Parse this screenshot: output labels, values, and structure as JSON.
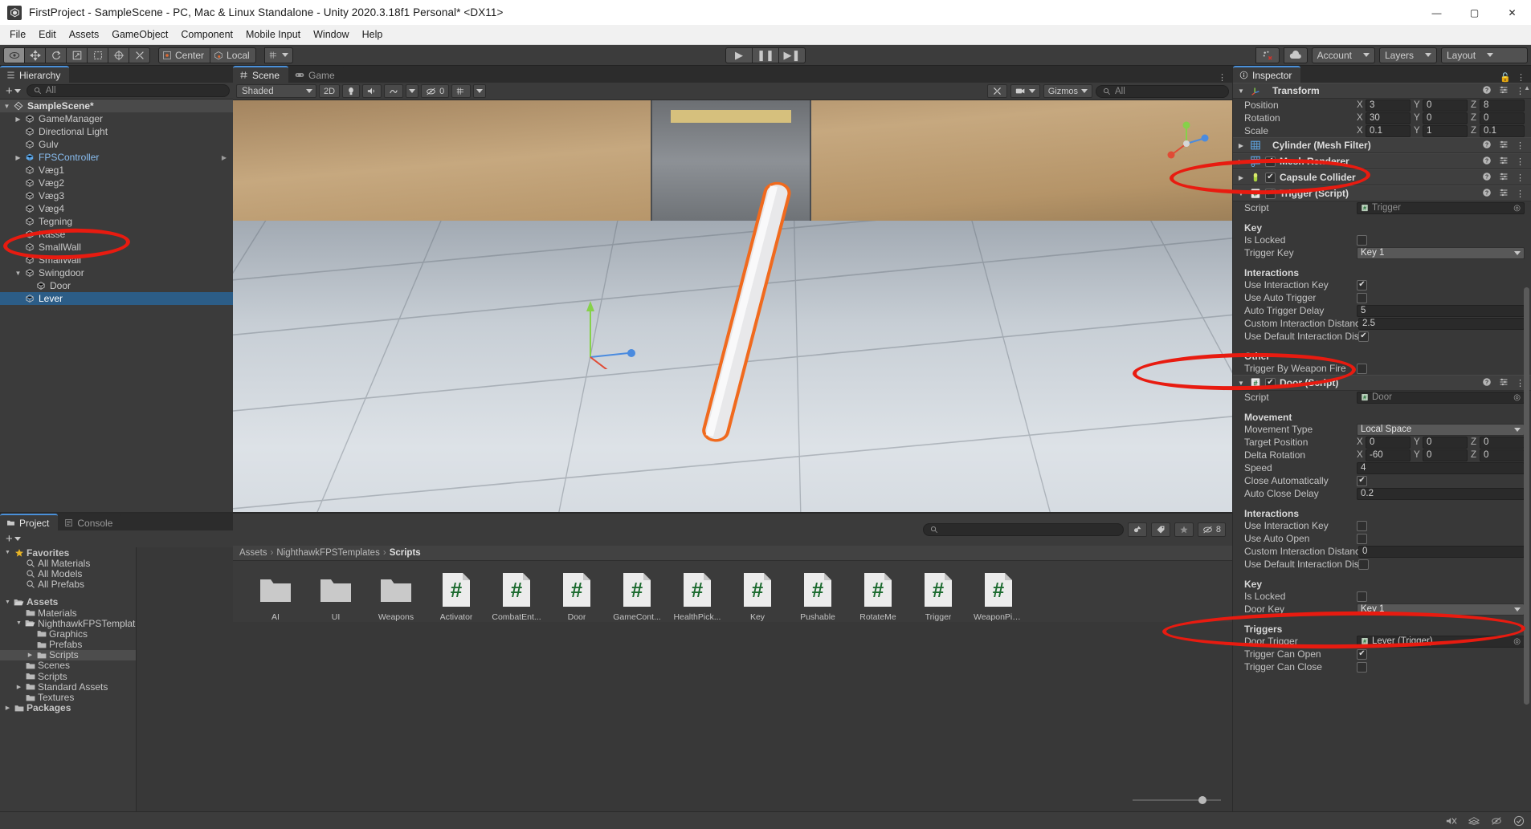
{
  "window": {
    "title": "FirstProject - SampleScene - PC, Mac & Linux Standalone - Unity 2020.3.18f1 Personal* <DX11>",
    "minimize": "—",
    "maximize": "▢",
    "close": "✕"
  },
  "menubar": {
    "items": [
      "File",
      "Edit",
      "Assets",
      "GameObject",
      "Component",
      "Mobile Input",
      "Window",
      "Help"
    ]
  },
  "toolbar": {
    "tools": [
      "hand-tool",
      "move-tool",
      "rotate-tool",
      "scale-tool",
      "rect-tool",
      "transform-tool",
      "custom-tool"
    ],
    "pivot_mode": "Center",
    "pivot_space": "Local",
    "play": "▶",
    "pause": "❚❚",
    "step": "▶❚",
    "collab_label": "",
    "cloud_label": "",
    "account": "Account",
    "layers": "Layers",
    "layout": "Layout"
  },
  "hierarchy": {
    "tab": "Hierarchy",
    "search_placeholder": "All",
    "create_label": "+",
    "items": [
      {
        "label": "SampleScene*",
        "depth": 0,
        "arrow": "▼",
        "type": "scene",
        "selected": false
      },
      {
        "label": "GameManager",
        "depth": 1,
        "arrow": "▶",
        "type": "go",
        "selected": false
      },
      {
        "label": "Directional Light",
        "depth": 1,
        "arrow": "",
        "type": "go",
        "selected": false
      },
      {
        "label": "Gulv",
        "depth": 1,
        "arrow": "",
        "type": "go",
        "selected": false
      },
      {
        "label": "FPSController",
        "depth": 1,
        "arrow": "▶",
        "type": "prefab",
        "selected": false
      },
      {
        "label": "Væg1",
        "depth": 1,
        "arrow": "",
        "type": "go",
        "selected": false
      },
      {
        "label": "Væg2",
        "depth": 1,
        "arrow": "",
        "type": "go",
        "selected": false
      },
      {
        "label": "Væg3",
        "depth": 1,
        "arrow": "",
        "type": "go",
        "selected": false
      },
      {
        "label": "Væg4",
        "depth": 1,
        "arrow": "",
        "type": "go",
        "selected": false
      },
      {
        "label": "Tegning",
        "depth": 1,
        "arrow": "",
        "type": "go",
        "selected": false
      },
      {
        "label": "Kasse",
        "depth": 1,
        "arrow": "",
        "type": "go",
        "selected": false
      },
      {
        "label": "SmallWall",
        "depth": 1,
        "arrow": "",
        "type": "go",
        "selected": false
      },
      {
        "label": "SmallWall",
        "depth": 1,
        "arrow": "",
        "type": "go",
        "selected": false
      },
      {
        "label": "Swingdoor",
        "depth": 1,
        "arrow": "▼",
        "type": "go",
        "selected": false
      },
      {
        "label": "Door",
        "depth": 2,
        "arrow": "",
        "type": "go",
        "selected": false
      },
      {
        "label": "Lever",
        "depth": 1,
        "arrow": "",
        "type": "go",
        "selected": true
      }
    ]
  },
  "scene_view": {
    "tabs": [
      {
        "label": "Scene",
        "active": true
      },
      {
        "label": "Game",
        "active": false
      }
    ],
    "shading_mode": "Shaded",
    "two_d": "2D",
    "audio": "",
    "effects_count": "0",
    "gizmos": "Gizmos",
    "search_placeholder": "All"
  },
  "project": {
    "tabs": [
      {
        "label": "Project",
        "active": true
      },
      {
        "label": "Console",
        "active": false
      }
    ],
    "search_placeholder": "",
    "hidden_count": "8",
    "breadcrumb": [
      "Assets",
      "NighthawkFPSTemplates",
      "Scripts"
    ],
    "tree": [
      {
        "label": "Favorites",
        "depth": 0,
        "arrow": "▼",
        "icon": "star",
        "bold": true,
        "sel": false
      },
      {
        "label": "All Materials",
        "depth": 1,
        "arrow": "",
        "icon": "search",
        "bold": false,
        "sel": false
      },
      {
        "label": "All Models",
        "depth": 1,
        "arrow": "",
        "icon": "search",
        "bold": false,
        "sel": false
      },
      {
        "label": "All Prefabs",
        "depth": 1,
        "arrow": "",
        "icon": "search",
        "bold": false,
        "sel": false
      },
      {
        "label": "",
        "depth": 0,
        "arrow": "",
        "icon": "none",
        "bold": false,
        "sel": false
      },
      {
        "label": "Assets",
        "depth": 0,
        "arrow": "▼",
        "icon": "folder-open",
        "bold": true,
        "sel": false
      },
      {
        "label": "Materials",
        "depth": 1,
        "arrow": "",
        "icon": "folder",
        "bold": false,
        "sel": false
      },
      {
        "label": "NighthawkFPSTemplates",
        "depth": 1,
        "arrow": "▼",
        "icon": "folder-open",
        "bold": false,
        "sel": false
      },
      {
        "label": "Graphics",
        "depth": 2,
        "arrow": "",
        "icon": "folder",
        "bold": false,
        "sel": false
      },
      {
        "label": "Prefabs",
        "depth": 2,
        "arrow": "",
        "icon": "folder",
        "bold": false,
        "sel": false
      },
      {
        "label": "Scripts",
        "depth": 2,
        "arrow": "▶",
        "icon": "folder",
        "bold": false,
        "sel": true
      },
      {
        "label": "Scenes",
        "depth": 1,
        "arrow": "",
        "icon": "folder",
        "bold": false,
        "sel": false
      },
      {
        "label": "Scripts",
        "depth": 1,
        "arrow": "",
        "icon": "folder",
        "bold": false,
        "sel": false
      },
      {
        "label": "Standard Assets",
        "depth": 1,
        "arrow": "▶",
        "icon": "folder",
        "bold": false,
        "sel": false
      },
      {
        "label": "Textures",
        "depth": 1,
        "arrow": "",
        "icon": "folder",
        "bold": false,
        "sel": false
      },
      {
        "label": "Packages",
        "depth": 0,
        "arrow": "▶",
        "icon": "folder",
        "bold": true,
        "sel": false
      }
    ],
    "assets": [
      {
        "name": "AI",
        "type": "folder"
      },
      {
        "name": "UI",
        "type": "folder"
      },
      {
        "name": "Weapons",
        "type": "folder"
      },
      {
        "name": "Activator",
        "type": "script"
      },
      {
        "name": "CombatEnt...",
        "type": "script"
      },
      {
        "name": "Door",
        "type": "script"
      },
      {
        "name": "GameCont...",
        "type": "script"
      },
      {
        "name": "HealthPick...",
        "type": "script"
      },
      {
        "name": "Key",
        "type": "script"
      },
      {
        "name": "Pushable",
        "type": "script"
      },
      {
        "name": "RotateMe",
        "type": "script"
      },
      {
        "name": "Trigger",
        "type": "script"
      },
      {
        "name": "WeaponPic...",
        "type": "script"
      }
    ]
  },
  "inspector": {
    "tab": "Inspector",
    "components": [
      {
        "name": "Transform",
        "icon": "transform-icon",
        "foldout": "▼",
        "has_checkbox": false,
        "rows": [
          {
            "kind": "vec3",
            "label": "Position",
            "x": "3",
            "y": "0",
            "z": "8"
          },
          {
            "kind": "vec3",
            "label": "Rotation",
            "x": "30",
            "y": "0",
            "z": "0"
          },
          {
            "kind": "vec3",
            "label": "Scale",
            "x": "0.1",
            "y": "1",
            "z": "0.1"
          }
        ]
      },
      {
        "name": "Cylinder (Mesh Filter)",
        "icon": "mesh-filter-icon",
        "foldout": "▶",
        "has_checkbox": false,
        "rows": []
      },
      {
        "name": "Mesh Renderer",
        "icon": "mesh-renderer-icon",
        "foldout": "▶",
        "has_checkbox": true,
        "checked": true,
        "rows": []
      },
      {
        "name": "Capsule Collider",
        "icon": "capsule-collider-icon",
        "foldout": "▶",
        "has_checkbox": true,
        "checked": true,
        "rows": []
      },
      {
        "name": "Trigger (Script)",
        "icon": "script-icon",
        "foldout": "▼",
        "has_checkbox": true,
        "checked": true,
        "rows": [
          {
            "kind": "obj",
            "label": "Script",
            "value": "Trigger",
            "disabled": true
          },
          {
            "kind": "spacer"
          },
          {
            "kind": "head",
            "label": "Key"
          },
          {
            "kind": "check",
            "label": "Is Locked",
            "checked": false
          },
          {
            "kind": "drop",
            "label": "Trigger Key",
            "value": "Key 1"
          },
          {
            "kind": "spacer"
          },
          {
            "kind": "head",
            "label": "Interactions"
          },
          {
            "kind": "check",
            "label": "Use Interaction Key",
            "checked": true
          },
          {
            "kind": "check",
            "label": "Use Auto Trigger",
            "checked": false
          },
          {
            "kind": "text",
            "label": "Auto Trigger Delay",
            "value": "5"
          },
          {
            "kind": "text",
            "label": "Custom Interaction Distance",
            "value": "2.5"
          },
          {
            "kind": "check",
            "label": "Use Default Interaction Dista",
            "checked": true
          },
          {
            "kind": "spacer"
          },
          {
            "kind": "head",
            "label": "Other"
          },
          {
            "kind": "check",
            "label": "Trigger By Weapon Fire",
            "checked": false
          }
        ]
      },
      {
        "name": "Door (Script)",
        "icon": "script-icon",
        "foldout": "▼",
        "has_checkbox": true,
        "checked": true,
        "rows": [
          {
            "kind": "obj",
            "label": "Script",
            "value": "Door",
            "disabled": true
          },
          {
            "kind": "spacer"
          },
          {
            "kind": "head",
            "label": "Movement"
          },
          {
            "kind": "drop",
            "label": "Movement Type",
            "value": "Local Space"
          },
          {
            "kind": "vec3",
            "label": "Target Position",
            "x": "0",
            "y": "0",
            "z": "0"
          },
          {
            "kind": "vec3",
            "label": "Delta Rotation",
            "x": "-60",
            "y": "0",
            "z": "0"
          },
          {
            "kind": "text",
            "label": "Speed",
            "value": "4"
          },
          {
            "kind": "check",
            "label": "Close Automatically",
            "checked": true
          },
          {
            "kind": "text",
            "label": "Auto Close Delay",
            "value": "0.2"
          },
          {
            "kind": "spacer"
          },
          {
            "kind": "head",
            "label": "Interactions"
          },
          {
            "kind": "check",
            "label": "Use Interaction Key",
            "checked": false
          },
          {
            "kind": "check",
            "label": "Use Auto Open",
            "checked": false
          },
          {
            "kind": "text",
            "label": "Custom Interaction Distance",
            "value": "0"
          },
          {
            "kind": "check",
            "label": "Use Default Interaction Dista",
            "checked": false
          },
          {
            "kind": "spacer"
          },
          {
            "kind": "head",
            "label": "Key"
          },
          {
            "kind": "check",
            "label": "Is Locked",
            "checked": false
          },
          {
            "kind": "drop",
            "label": "Door Key",
            "value": "Key 1"
          },
          {
            "kind": "spacer"
          },
          {
            "kind": "head",
            "label": "Triggers"
          },
          {
            "kind": "obj",
            "label": "Door Trigger",
            "value": "Lever (Trigger)",
            "disabled": false
          },
          {
            "kind": "check",
            "label": "Trigger Can Open",
            "checked": true
          },
          {
            "kind": "check",
            "label": "Trigger Can Close",
            "checked": false
          }
        ]
      }
    ]
  },
  "annotations": {
    "color": "#e81b10",
    "marks": [
      "lever-hierarchy-item",
      "trigger-script-component",
      "door-script-component",
      "door-trigger-field"
    ]
  },
  "statusbar": {
    "message": ""
  }
}
